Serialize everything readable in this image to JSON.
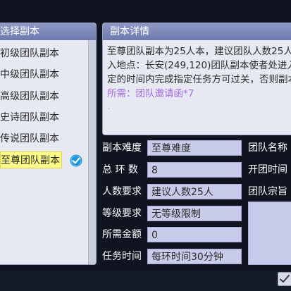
{
  "left": {
    "title": "选择副本",
    "items": [
      {
        "label": "初级团队副本"
      },
      {
        "label": "中级团队副本"
      },
      {
        "label": "高级团队副本"
      },
      {
        "label": "史诗团队副本"
      },
      {
        "label": "传说团队副本"
      },
      {
        "label": "至尊团队副本",
        "selected": true
      }
    ]
  },
  "detail": {
    "title": "副本详情",
    "line1": "至尊团队副本为25人本，建议团队人数25人",
    "line2": "入地点：长安(249,120)团队副本使者处进入",
    "line3": "定的时间内完成指定任务方可过关，否则副本",
    "requirement": "所需：团队邀请函*7"
  },
  "form": {
    "difficulty_label": "副本难度",
    "difficulty_value": "至尊难度",
    "rounds_label": "总 环 数",
    "rounds_value": "8",
    "members_label": "人数要求",
    "members_value": "建议人数25人",
    "level_label": "等级要求",
    "level_value": "无等级限制",
    "gold_label": "所需金额",
    "gold_value": "0",
    "time_label": "任务时间",
    "time_value": "每环时间30分钟"
  },
  "team": {
    "name_label": "团队名称",
    "start_label": "开团时间",
    "purpose_label": "团队宗旨"
  },
  "colors": {
    "header": "#7e89bd",
    "selected_bg": "#ffff88",
    "field_bg": "#c9cbeb",
    "requirement": "#a46adf"
  }
}
